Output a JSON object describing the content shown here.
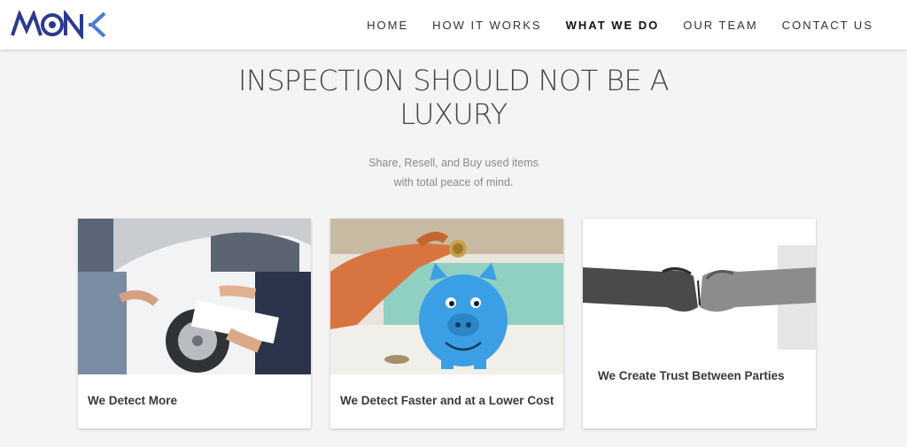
{
  "brand": {
    "logo_text": "MONK",
    "colors": {
      "primary": "#2c3a8c",
      "accent": "#4f79d6"
    }
  },
  "nav": {
    "items": [
      {
        "label": "HOME",
        "active": false
      },
      {
        "label": "HOW IT WORKS",
        "active": false
      },
      {
        "label": "WHAT WE DO",
        "active": true
      },
      {
        "label": "OUR TEAM",
        "active": false
      },
      {
        "label": "CONTACT US",
        "active": false
      }
    ]
  },
  "hero": {
    "title_line1": "INSPECTION SHOULD NOT BE A",
    "title_line2": "LUXURY",
    "subtitle_line1": "Share, Resell, and Buy used items",
    "subtitle_line2": "with total peace of mind."
  },
  "cards": [
    {
      "caption": "We Detect More",
      "image_icon": "car-inspection-photo"
    },
    {
      "caption": "We Detect Faster and at a Lower Cost",
      "image_icon": "piggy-bank-photo"
    },
    {
      "caption": "We Create Trust Between Parties",
      "image_icon": "fist-bump-photo"
    }
  ]
}
